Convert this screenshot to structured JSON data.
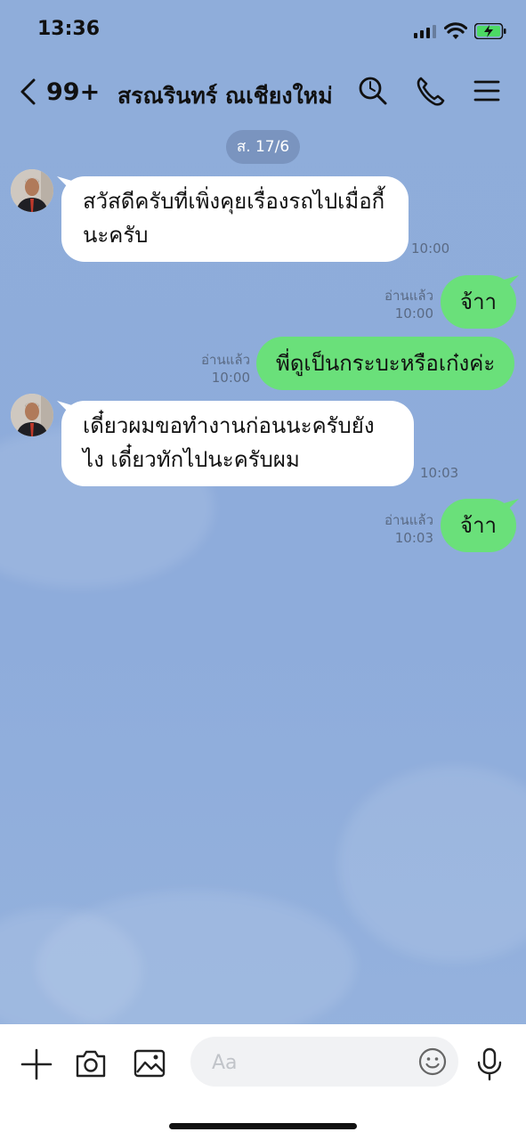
{
  "status_bar": {
    "time": "13:36"
  },
  "header": {
    "back_count": "99+",
    "title": "สรณรินทร์ ณเชียงใหม่"
  },
  "date_divider": "ส. 17/6",
  "messages": [
    {
      "side": "in",
      "text": "สวัสดีครับที่เพิ่งคุยเรื่องรถไปเมื่อกี้ นะครับ",
      "time": "10:00"
    },
    {
      "side": "out",
      "text": "จ้าา",
      "read": "อ่านแล้ว",
      "time": "10:00"
    },
    {
      "side": "out",
      "text": "พี่ดูเป็นกระบะหรือเก๋งค่ะ",
      "read": "อ่านแล้ว",
      "time": "10:00"
    },
    {
      "side": "in",
      "text": "เดี๋ยวผมขอทำงานก่อนนะครับยังไง เดี๋ยวทักไปนะครับผม",
      "time": "10:03"
    },
    {
      "side": "out",
      "text": "จ้าา",
      "read": "อ่านแล้ว",
      "time": "10:03"
    }
  ],
  "input": {
    "placeholder": "Aa"
  },
  "colors": {
    "background": "#8dabdb",
    "outgoing_bubble": "#6ae07a",
    "incoming_bubble": "#ffffff",
    "date_pill": "#7a94bf"
  },
  "icons": [
    "back-chevron-icon",
    "search-icon",
    "phone-icon",
    "menu-icon",
    "plus-icon",
    "camera-icon",
    "image-icon",
    "emoji-icon",
    "microphone-icon"
  ]
}
